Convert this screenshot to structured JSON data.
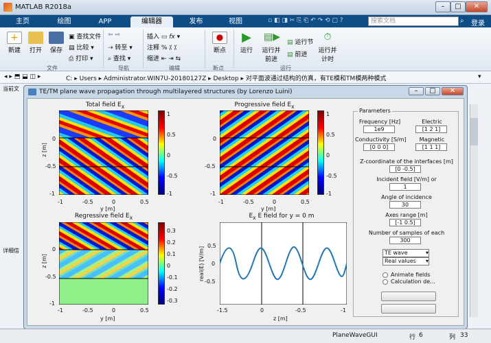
{
  "app": {
    "title": "MATLAB R2018a"
  },
  "tabs": [
    "主页",
    "绘图",
    "APP",
    "编辑器",
    "发布",
    "视图"
  ],
  "search_placeholder": "搜索文档",
  "login": "登录",
  "ribbon": {
    "new": "新建",
    "open": "打开",
    "save": "保存",
    "find_files": "查找文件",
    "compare": "比较",
    "print": "打印",
    "goto": "转至",
    "find": "查找",
    "insert": "插入",
    "comment": "注释",
    "indent": "缩进",
    "breakpoints": "断点",
    "run": "运行",
    "run_advance": "运行并\n前进",
    "run_section": "运行节",
    "advance": "前进",
    "run_time": "运行并\n计时",
    "groups": [
      "文件",
      "导航",
      "编辑",
      "断点",
      "运行"
    ]
  },
  "address": {
    "parts": [
      "C:",
      "Users",
      "Administrator.WIN7U-20180127Z",
      "Desktop",
      "对平面波通过结构的仿真，有TE模和TM模两种模式"
    ]
  },
  "side": {
    "current": "当前文",
    "detail": "详细信"
  },
  "status": {
    "file": "PlaneWaveGUI",
    "row_label": "行",
    "row": "6",
    "col_label": "列",
    "col": "33"
  },
  "figure": {
    "title": "TE/TM plane wave propagation through multilayered structures (by Lorenzo Luini)",
    "plots": {
      "total": "Total field E",
      "prog": "Progressive field E",
      "regr": "Regressive field E",
      "line": "E field for y = 0 m",
      "sub_x": "x"
    },
    "axes": {
      "y": "y [m]",
      "z": "z [m]",
      "real": "real(E) [V/m]"
    },
    "ticks_x": [
      "-1",
      "-0.5",
      "0",
      "0.5"
    ],
    "ticks_z": [
      "0",
      "-0.5",
      "-1"
    ],
    "cb_ticks": [
      "1",
      "0.5",
      "0",
      "-0.5",
      "-1"
    ],
    "cb_ticks_r": [
      "0.3",
      "0.2",
      "0.1",
      "0",
      "-0.1",
      "-0.2",
      "-0.3"
    ],
    "line_ticks_x": [
      "0",
      "-0.5",
      "-1"
    ],
    "line_ticks_x_first": "-1.5",
    "line_ticks_y": [
      "0.5",
      "0",
      "-0.5"
    ],
    "params": {
      "title": "Parameters",
      "freq_label": "Frequency [Hz]",
      "freq": "1e9",
      "electric_label": "Electric",
      "electric": "[1 2 1]",
      "cond_label": "Conductivity [S/m]",
      "cond": "[0 0 0]",
      "mag_label": "Magnetic",
      "mag": "[1 1 1]",
      "zcoord_label": "Z-coordinate of the interfaces [m]",
      "zcoord": "[0 -0.5]",
      "incident_label": "Incident field [V/m] or",
      "incident": "1",
      "angle_label": "Angle of incidence",
      "angle": "30",
      "axes_label": "Axes range [m]",
      "axes": "[-1 0.5]",
      "samples_label": "Number of samples of each",
      "samples": "300",
      "mode": "TE wave",
      "values": "Real values",
      "animate": "Animate fields",
      "calc": "Calculation de..."
    }
  }
}
